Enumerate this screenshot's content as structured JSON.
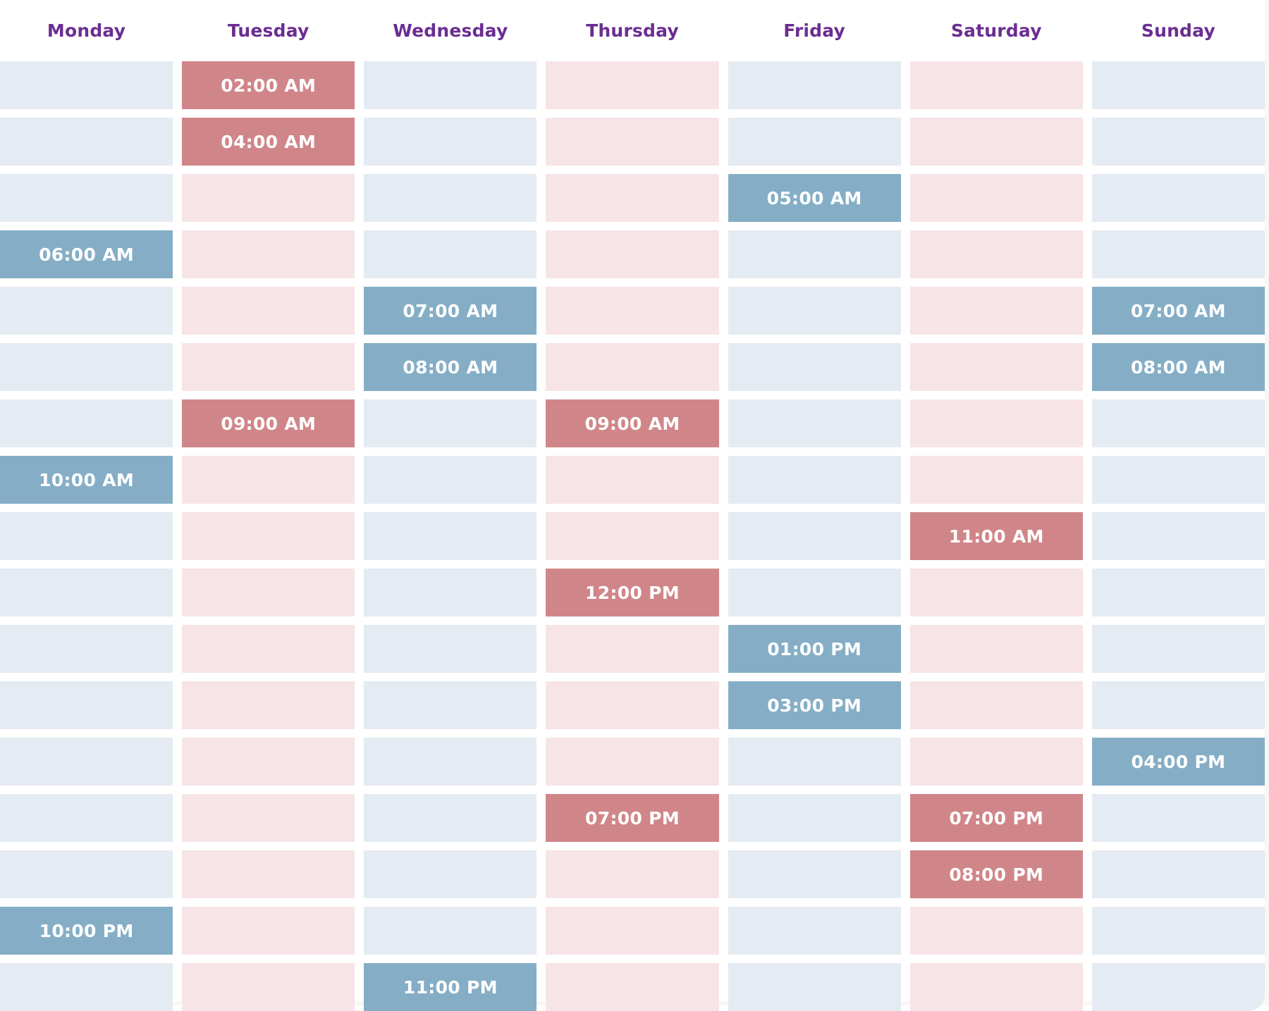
{
  "header": {
    "days": [
      {
        "label": "Monday",
        "tone": "blue"
      },
      {
        "label": "Tuesday",
        "tone": "pink"
      },
      {
        "label": "Wednesday",
        "tone": "blue"
      },
      {
        "label": "Thursday",
        "tone": "pink"
      },
      {
        "label": "Friday",
        "tone": "blue"
      },
      {
        "label": "Saturday",
        "tone": "pink"
      },
      {
        "label": "Sunday",
        "tone": "blue"
      }
    ]
  },
  "colors": {
    "header_text": "#6b2d91",
    "empty_blue": "#e4ebf3",
    "empty_pink": "#f7e4e6",
    "selected_blue": "#85aec6",
    "selected_red": "#d08689",
    "slot_label_text": "#ffffff",
    "page_background": "#ffffff",
    "outer_background": "#faf6f3"
  },
  "grid": {
    "columns": 7,
    "rows": 17,
    "rows_data": [
      {
        "cells": [
          null,
          "02:00 AM",
          null,
          null,
          null,
          null,
          null
        ]
      },
      {
        "cells": [
          null,
          "04:00 AM",
          null,
          null,
          null,
          null,
          null
        ]
      },
      {
        "cells": [
          null,
          null,
          null,
          null,
          "05:00 AM",
          null,
          null
        ]
      },
      {
        "cells": [
          "06:00 AM",
          null,
          null,
          null,
          null,
          null,
          null
        ]
      },
      {
        "cells": [
          null,
          null,
          "07:00 AM",
          null,
          null,
          null,
          "07:00 AM"
        ]
      },
      {
        "cells": [
          null,
          null,
          "08:00 AM",
          null,
          null,
          null,
          "08:00 AM"
        ]
      },
      {
        "cells": [
          null,
          "09:00 AM",
          null,
          "09:00 AM",
          null,
          null,
          null
        ]
      },
      {
        "cells": [
          "10:00 AM",
          null,
          null,
          null,
          null,
          null,
          null
        ]
      },
      {
        "cells": [
          null,
          null,
          null,
          null,
          null,
          "11:00 AM",
          null
        ]
      },
      {
        "cells": [
          null,
          null,
          null,
          "12:00 PM",
          null,
          null,
          null
        ]
      },
      {
        "cells": [
          null,
          null,
          null,
          null,
          "01:00 PM",
          null,
          null
        ]
      },
      {
        "cells": [
          null,
          null,
          null,
          null,
          "03:00 PM",
          null,
          null
        ]
      },
      {
        "cells": [
          null,
          null,
          null,
          null,
          null,
          null,
          "04:00 PM"
        ]
      },
      {
        "cells": [
          null,
          null,
          null,
          "07:00 PM",
          null,
          "07:00 PM",
          null
        ]
      },
      {
        "cells": [
          null,
          null,
          null,
          null,
          null,
          "08:00 PM",
          null
        ]
      },
      {
        "cells": [
          "10:00 PM",
          null,
          null,
          null,
          null,
          null,
          null
        ]
      },
      {
        "cells": [
          null,
          null,
          "11:00 PM",
          null,
          null,
          null,
          null
        ]
      }
    ]
  },
  "selected_times": [
    {
      "day": "Tuesday",
      "time": "02:00 AM",
      "tone": "red"
    },
    {
      "day": "Tuesday",
      "time": "04:00 AM",
      "tone": "red"
    },
    {
      "day": "Friday",
      "time": "05:00 AM",
      "tone": "blue"
    },
    {
      "day": "Monday",
      "time": "06:00 AM",
      "tone": "blue"
    },
    {
      "day": "Wednesday",
      "time": "07:00 AM",
      "tone": "blue"
    },
    {
      "day": "Sunday",
      "time": "07:00 AM",
      "tone": "blue"
    },
    {
      "day": "Wednesday",
      "time": "08:00 AM",
      "tone": "blue"
    },
    {
      "day": "Sunday",
      "time": "08:00 AM",
      "tone": "blue"
    },
    {
      "day": "Tuesday",
      "time": "09:00 AM",
      "tone": "red"
    },
    {
      "day": "Thursday",
      "time": "09:00 AM",
      "tone": "red"
    },
    {
      "day": "Monday",
      "time": "10:00 AM",
      "tone": "blue"
    },
    {
      "day": "Saturday",
      "time": "11:00 AM",
      "tone": "red"
    },
    {
      "day": "Thursday",
      "time": "12:00 PM",
      "tone": "red"
    },
    {
      "day": "Friday",
      "time": "01:00 PM",
      "tone": "blue"
    },
    {
      "day": "Friday",
      "time": "03:00 PM",
      "tone": "blue"
    },
    {
      "day": "Sunday",
      "time": "04:00 PM",
      "tone": "blue"
    },
    {
      "day": "Thursday",
      "time": "07:00 PM",
      "tone": "red"
    },
    {
      "day": "Saturday",
      "time": "07:00 PM",
      "tone": "red"
    },
    {
      "day": "Saturday",
      "time": "08:00 PM",
      "tone": "red"
    },
    {
      "day": "Monday",
      "time": "10:00 PM",
      "tone": "blue"
    },
    {
      "day": "Wednesday",
      "time": "11:00 PM",
      "tone": "blue"
    }
  ]
}
